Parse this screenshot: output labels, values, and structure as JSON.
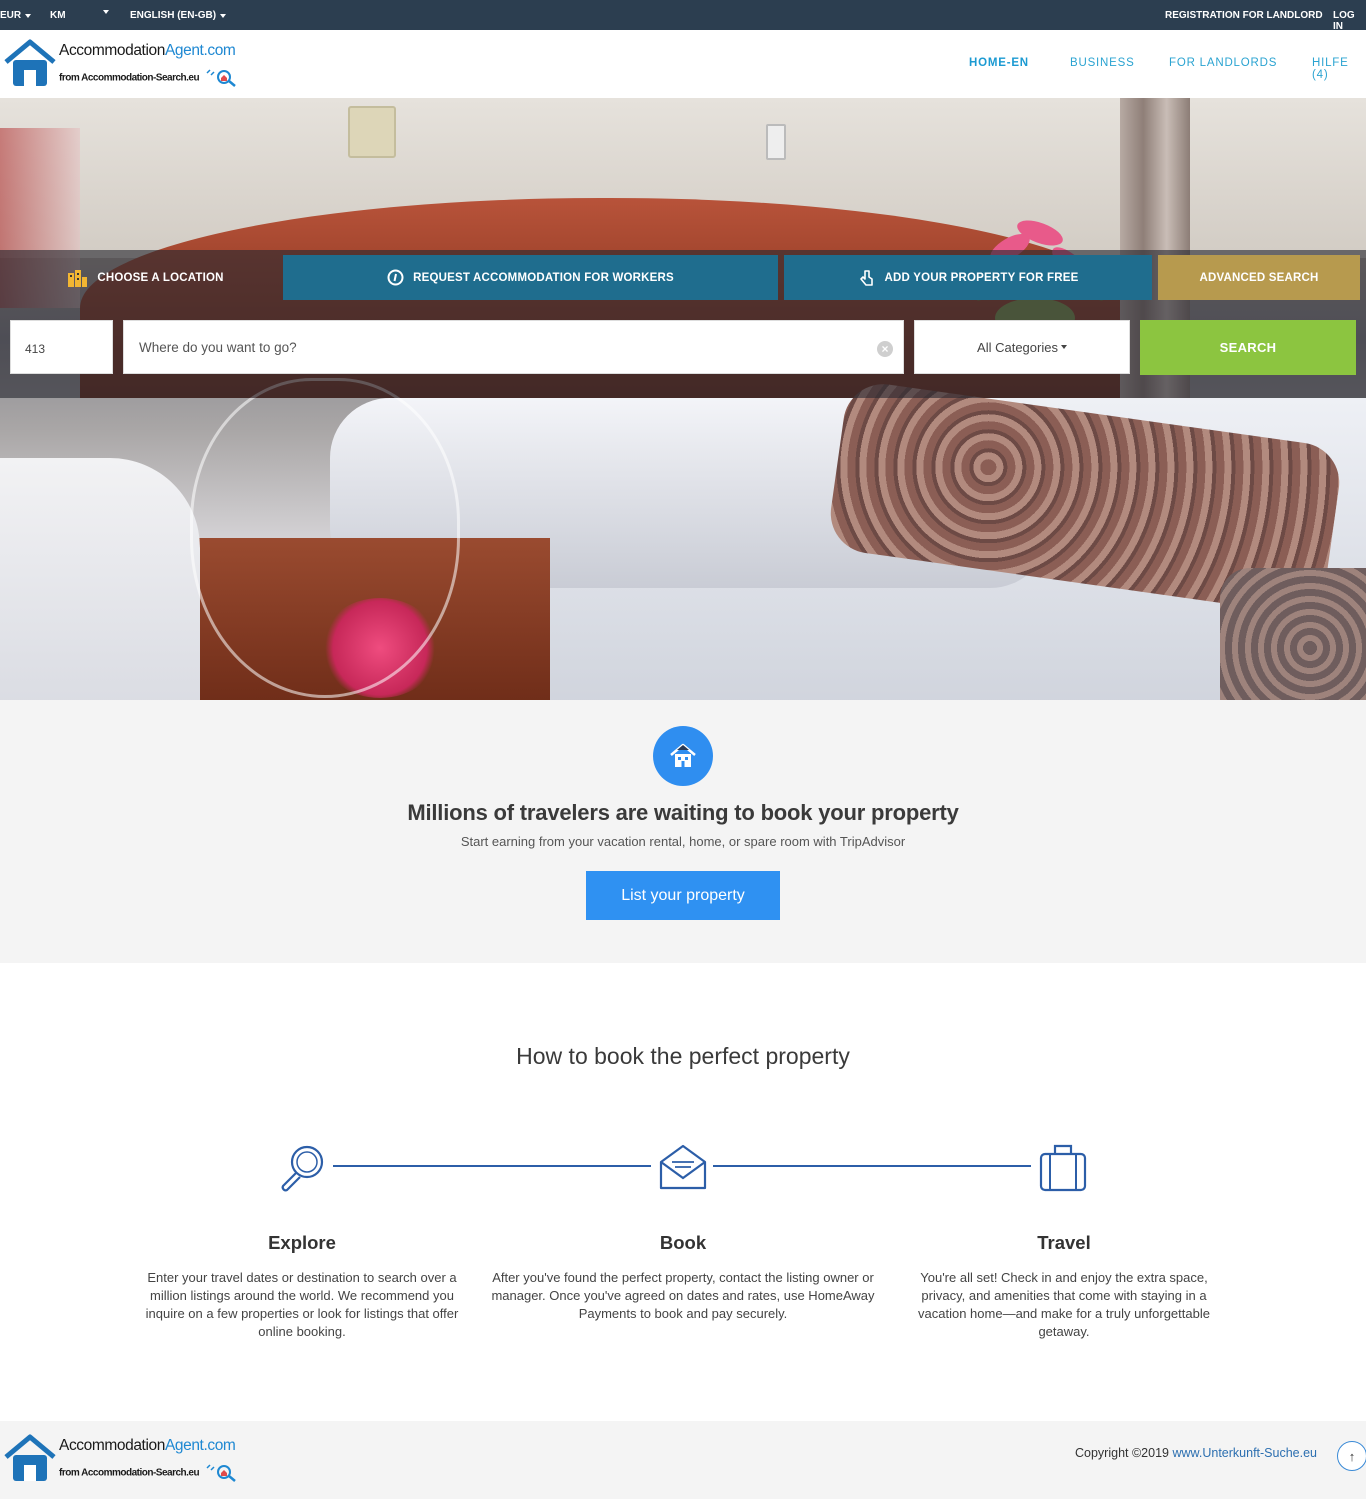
{
  "topbar": {
    "currency": "EUR",
    "unit": "KM",
    "language": "ENGLISH (EN-GB)",
    "register": "REGISTRATION FOR LANDLORD",
    "login": "LOG IN"
  },
  "brand": {
    "name_part1": "Accommodation",
    "name_part2": "Agent.com",
    "tagline": "from Accommodation-Search.eu"
  },
  "nav": [
    {
      "label": "HOME-EN",
      "active": true
    },
    {
      "label": "BUSINESS",
      "active": false
    },
    {
      "label": "FOR LANDLORDS",
      "active": false
    },
    {
      "label": "HILFE (4)",
      "active": false
    }
  ],
  "search_tabs": {
    "location": "CHOOSE A LOCATION",
    "workers": "REQUEST ACCOMMODATION FOR WORKERS",
    "add_property": "ADD YOUR PROPERTY FOR FREE",
    "advanced": "ADVANCED SEARCH"
  },
  "search": {
    "radius_value": "413",
    "where_placeholder": "Where do you want to go?",
    "category_selected": "All Categories",
    "button": "SEARCH"
  },
  "promo": {
    "title": "Millions of travelers are waiting to book your property",
    "subtitle": "Start earning from your vacation rental, home, or spare room with TripAdvisor",
    "button": "List your property"
  },
  "howto": {
    "title": "How to book the perfect property",
    "steps": [
      {
        "title": "Explore",
        "icon": "magnifier-icon",
        "text": "Enter your travel dates or destination to search over a million listings around the world. We recommend you inquire on a few properties or look for listings that offer online booking."
      },
      {
        "title": "Book",
        "icon": "envelope-icon",
        "text": "After you've found the perfect property, contact the listing owner or manager. Once you've agreed on dates and rates, use HomeAway Payments to book and pay securely."
      },
      {
        "title": "Travel",
        "icon": "suitcase-icon",
        "text": "You're all set! Check in and enjoy the extra space, privacy, and amenities that come with staying in a vacation home—and make for a truly unforgettable getaway."
      }
    ]
  },
  "footer": {
    "copyright": "Copyright ©2019",
    "link": "www.Unterkunft-Suche.eu",
    "to_top": "↑"
  },
  "colors": {
    "topbar": "#2c3e50",
    "nav": "#2aa3d1",
    "tab_teal": "#1f6d8e",
    "tab_gold": "#b79a4e",
    "search_green": "#8cc540",
    "primary_blue": "#2f91f2",
    "step_icon": "#2c5ea8"
  }
}
